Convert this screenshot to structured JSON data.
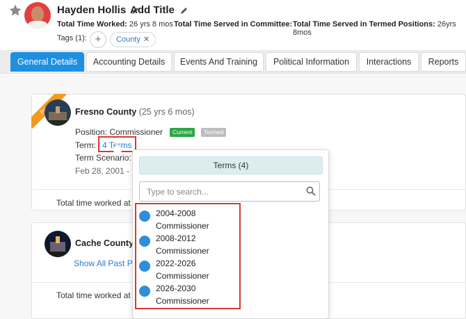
{
  "header": {
    "name": "Hayden Hollis",
    "add_title": "Add Title",
    "total_worked_label": "Total Time Worked:",
    "total_worked_value": "26 yrs 8 mos",
    "served_committee_label": "Total Time Served in Committee:",
    "served_termed_label": "Total Time Served in Termed Positions:",
    "served_termed_value": "26yrs 8mos",
    "tags_label": "Tags (1):",
    "tag_add": "+",
    "tag_chip": "County",
    "tag_remove": "✕"
  },
  "tabs": [
    {
      "label": "General Details",
      "active": true
    },
    {
      "label": "Accounting Details",
      "active": false
    },
    {
      "label": "Events And Training",
      "active": false
    },
    {
      "label": "Political Information",
      "active": false
    },
    {
      "label": "Interactions",
      "active": false
    },
    {
      "label": "Reports",
      "active": false
    }
  ],
  "fresno": {
    "ribbon": "Primary",
    "county": "Fresno County",
    "duration": "(25 yrs 6 mos)",
    "position_label": "Position:",
    "position_value": "Commissioner",
    "badge_current": "Current",
    "badge_termed": "Termed",
    "term_label": "Term:",
    "term_link": "4 Terms",
    "scenario_label": "Term Scenario:",
    "date_partial": "Feb 28, 2001 - p",
    "total_worked": "Total time worked at"
  },
  "cache": {
    "county": "Cache County",
    "duration_partial": "(",
    "show_all": "Show All Past P",
    "total_worked": "Total time worked at"
  },
  "popover": {
    "title": "Terms (4)",
    "search_placeholder": "Type to search...",
    "terms": [
      {
        "range": "2004-2008",
        "role": "Commissioner"
      },
      {
        "range": "2008-2012",
        "role": "Commissioner"
      },
      {
        "range": "2022-2026",
        "role": "Commissioner"
      },
      {
        "range": "2026-2030",
        "role": "Commissioner"
      }
    ]
  },
  "colors": {
    "accent": "#1e8fe1",
    "current": "#2aa745",
    "termed": "#bdbdbd",
    "primary_ribbon": "#f39a1e",
    "highlight": "#d53a32"
  }
}
